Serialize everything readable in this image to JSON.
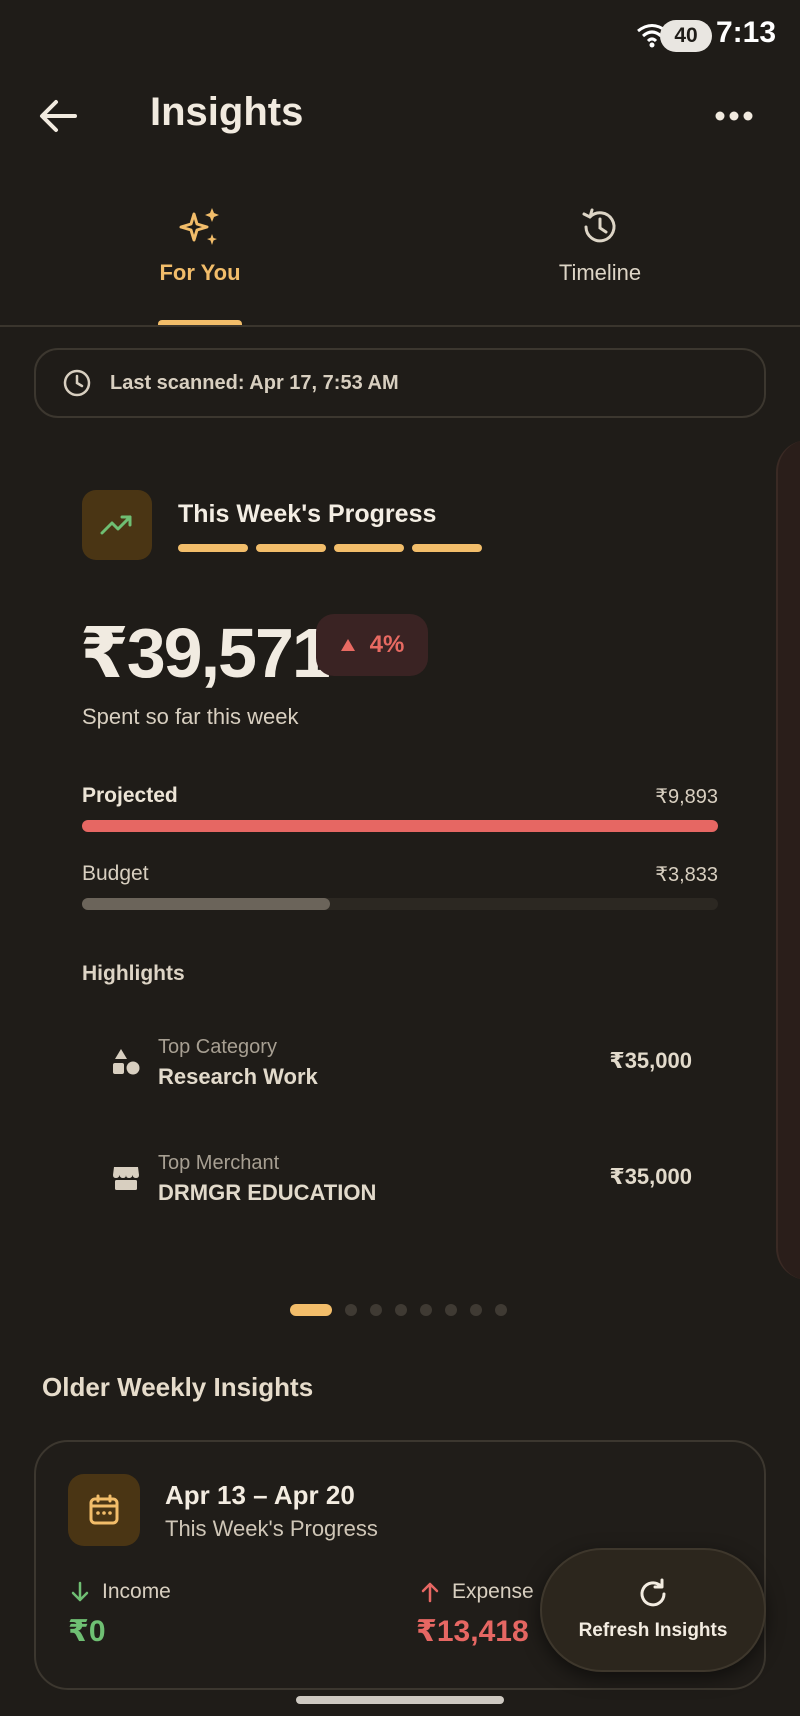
{
  "status_bar": {
    "time": "7:13",
    "battery": "40"
  },
  "header": {
    "title": "Insights"
  },
  "tabs": [
    {
      "label": "For You",
      "icon": "sparkles-icon",
      "active": true
    },
    {
      "label": "Timeline",
      "icon": "history-icon",
      "active": false
    }
  ],
  "scan": {
    "text": "Last scanned: Apr 17, 7:53 AM"
  },
  "progress_card": {
    "title": "This Week's Progress",
    "amount": "₹39,571",
    "change": "4%",
    "change_direction": "up",
    "subtitle": "Spent so far this week",
    "projected": {
      "label": "Projected",
      "value": "₹9,893",
      "fill_fraction": 1.0
    },
    "budget": {
      "label": "Budget",
      "value": "₹3,833",
      "fill_fraction": 0.39
    },
    "highlights_heading": "Highlights",
    "highlights": [
      {
        "kicker": "Top Category",
        "title": "Research Work",
        "amount": "₹35,000",
        "icon": "shapes-icon"
      },
      {
        "kicker": "Top Merchant",
        "title": "DRMGR EDUCATION",
        "amount": "₹35,000",
        "icon": "store-icon"
      }
    ]
  },
  "pager": {
    "count": 8,
    "active_index": 0
  },
  "older": {
    "heading": "Older Weekly Insights",
    "card": {
      "range": "Apr 13 – Apr 20",
      "subtitle": "This Week's Progress",
      "income_label": "Income",
      "income_value": "₹0",
      "expense_label": "Expense",
      "expense_value": "₹13,418"
    }
  },
  "fab": {
    "label": "Refresh Insights"
  },
  "colors": {
    "accent": "#f2bd6a",
    "negative": "#e66763",
    "positive": "#6fbf73",
    "background": "#1f1c18"
  }
}
